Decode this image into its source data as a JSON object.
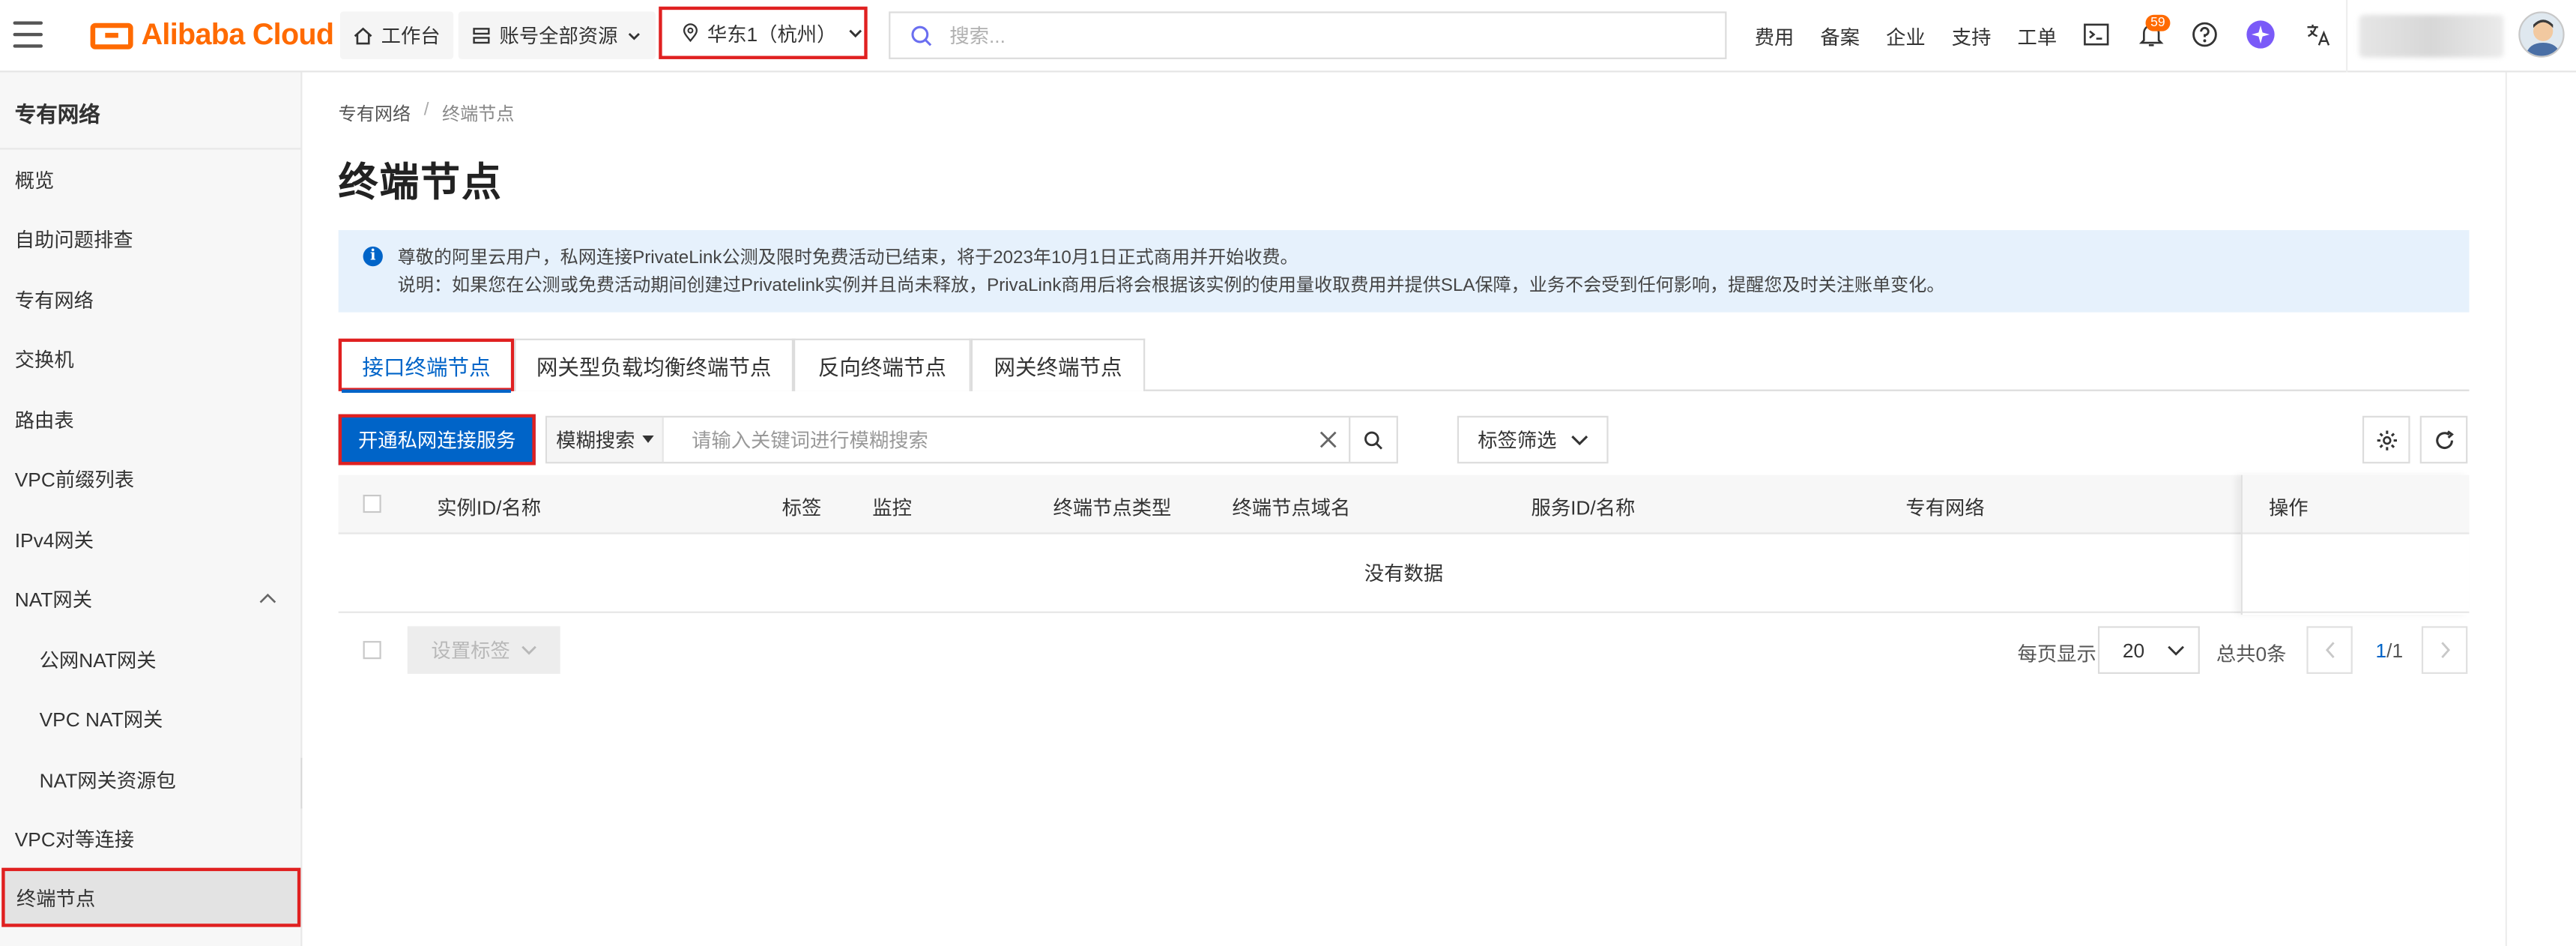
{
  "topbar": {
    "brand": "Alibaba Cloud",
    "workbench": "工作台",
    "resources": "账号全部资源",
    "region": "华东1（杭州）",
    "search_placeholder": "搜索...",
    "nav": [
      "费用",
      "备案",
      "企业",
      "支持",
      "工单"
    ],
    "notification_count": "59"
  },
  "sidebar": {
    "title": "专有网络",
    "items": [
      {
        "label": "概览"
      },
      {
        "label": "自助问题排查"
      },
      {
        "label": "专有网络"
      },
      {
        "label": "交换机"
      },
      {
        "label": "路由表"
      },
      {
        "label": "VPC前缀列表"
      },
      {
        "label": "IPv4网关"
      },
      {
        "label": "NAT网关"
      },
      {
        "label": "公网NAT网关"
      },
      {
        "label": "VPC NAT网关"
      },
      {
        "label": "NAT网关资源包"
      },
      {
        "label": "VPC对等连接"
      },
      {
        "label": "终端节点"
      }
    ]
  },
  "breadcrumb": {
    "root": "专有网络",
    "sep": "/",
    "current": "终端节点"
  },
  "page": {
    "title": "终端节点"
  },
  "notice": {
    "line1": "尊敬的阿里云用户，私网连接PrivateLink公测及限时免费活动已结束，将于2023年10月1日正式商用并开始收费。",
    "line2": "说明：如果您在公测或免费活动期间创建过Privatelink实例并且尚未释放，PrivaLink商用后将会根据该实例的使用量收取费用并提供SLA保障，业务不会受到任何影响，提醒您及时关注账单变化。"
  },
  "tabs": [
    "接口终端节点",
    "网关型负载均衡终端节点",
    "反向终端节点",
    "网关终端节点"
  ],
  "toolbar": {
    "create_button": "开通私网连接服务",
    "filter_mode": "模糊搜索",
    "search_placeholder": "请输入关键词进行模糊搜索",
    "tag_filter": "标签筛选"
  },
  "table": {
    "columns": [
      "实例ID/名称",
      "标签",
      "监控",
      "终端节点类型",
      "终端节点域名",
      "服务ID/名称",
      "专有网络",
      "操作"
    ],
    "empty_text": "没有数据"
  },
  "footer": {
    "set_tags": "设置标签",
    "per_page_label": "每页显示",
    "per_page": "20",
    "total": "总共0条",
    "current_page": "1",
    "total_pages": "/1"
  },
  "colors": {
    "brand": "#ff6a00",
    "primary": "#0064c8",
    "highlight": "#e02020",
    "notice_bg": "#e6f1fc"
  }
}
